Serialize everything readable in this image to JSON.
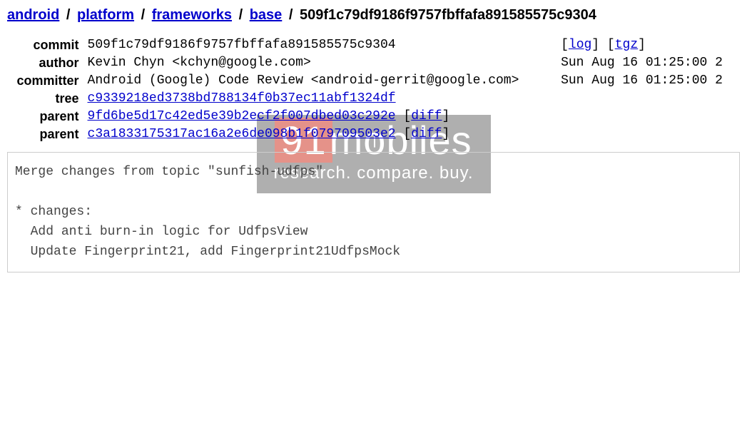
{
  "breadcrumb": {
    "parts": [
      {
        "label": "android",
        "link": true
      },
      {
        "label": "platform",
        "link": true
      },
      {
        "label": "frameworks",
        "link": true
      },
      {
        "label": "base",
        "link": true
      },
      {
        "label": "509f1c79df9186f9757fbffafa891585575c9304",
        "link": false
      }
    ],
    "separator": "/"
  },
  "meta": {
    "commit_label": "commit",
    "commit_hash": "509f1c79df9186f9757fbffafa891585575c9304",
    "log_link": "log",
    "tgz_link": "tgz",
    "author_label": "author",
    "author_value": "Kevin Chyn <kchyn@google.com>",
    "author_date": "Sun Aug 16 01:25:00 2",
    "committer_label": "committer",
    "committer_value": "Android (Google) Code Review <android-gerrit@google.com>",
    "committer_date": "Sun Aug 16 01:25:00 2",
    "tree_label": "tree",
    "tree_hash": "c9339218ed3738bd788134f0b37ec11abf1324df",
    "parent_label": "parent",
    "parent1_hash": "9fd6be5d17c42ed5e39b2ecf2f007dbed03c292e",
    "parent2_hash": "c3a1833175317ac16a2e6de098b1f079709503e2",
    "diff_label": "diff"
  },
  "commit_message": "Merge changes from topic \"sunfish-udfps\"\n\n* changes:\n  Add anti burn-in logic for UdfpsView\n  Update Fingerprint21, add Fingerprint21UdfpsMock",
  "watermark": {
    "brand_num": "91",
    "brand_text": "mobiles",
    "tagline": "research. compare. buy."
  }
}
